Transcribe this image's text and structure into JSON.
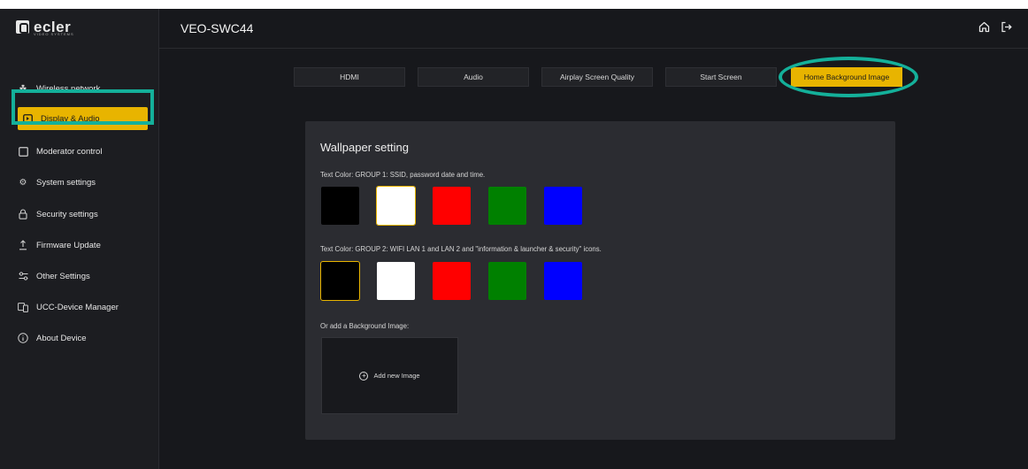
{
  "brand": {
    "name": "ecler",
    "tagline": "VIDEO SYSTEMS"
  },
  "header": {
    "title": "VEO-SWC44",
    "icons": [
      "home-icon",
      "logout-icon"
    ]
  },
  "sidebar": {
    "items": [
      {
        "label": "Wireless network",
        "icon": "network-icon"
      },
      {
        "label": "Display & Audio",
        "icon": "display-icon",
        "active": true
      },
      {
        "label": "Moderator control",
        "icon": "square-icon"
      },
      {
        "label": "System settings",
        "icon": "gear-icon"
      },
      {
        "label": "Security settings",
        "icon": "lock-icon"
      },
      {
        "label": "Firmware Update",
        "icon": "upload-icon"
      },
      {
        "label": "Other Settings",
        "icon": "sliders-icon"
      },
      {
        "label": "UCC-Device Manager",
        "icon": "devices-icon"
      },
      {
        "label": "About Device",
        "icon": "info-icon"
      }
    ]
  },
  "tabs": [
    {
      "label": "HDMI"
    },
    {
      "label": "Audio"
    },
    {
      "label": "Airplay Screen Quality"
    },
    {
      "label": "Start Screen"
    },
    {
      "label": "Home Background Image",
      "active": true
    }
  ],
  "panel": {
    "title": "Wallpaper setting",
    "group1_label": "Text Color: GROUP 1: SSID, password date and time.",
    "group2_label": "Text Color: GROUP 2: WIFI LAN 1 and LAN 2 and \"information & launcher & security\" icons.",
    "background_label": "Or add a Background Image:",
    "add_image_label": "Add new Image",
    "group1_selected": "white",
    "group2_selected": "black"
  },
  "colors": {
    "accent": "#e8b400",
    "highlight": "#14b09a",
    "swatches": [
      "#000000",
      "#ffffff",
      "#ff0000",
      "#008000",
      "#0000ff"
    ]
  }
}
